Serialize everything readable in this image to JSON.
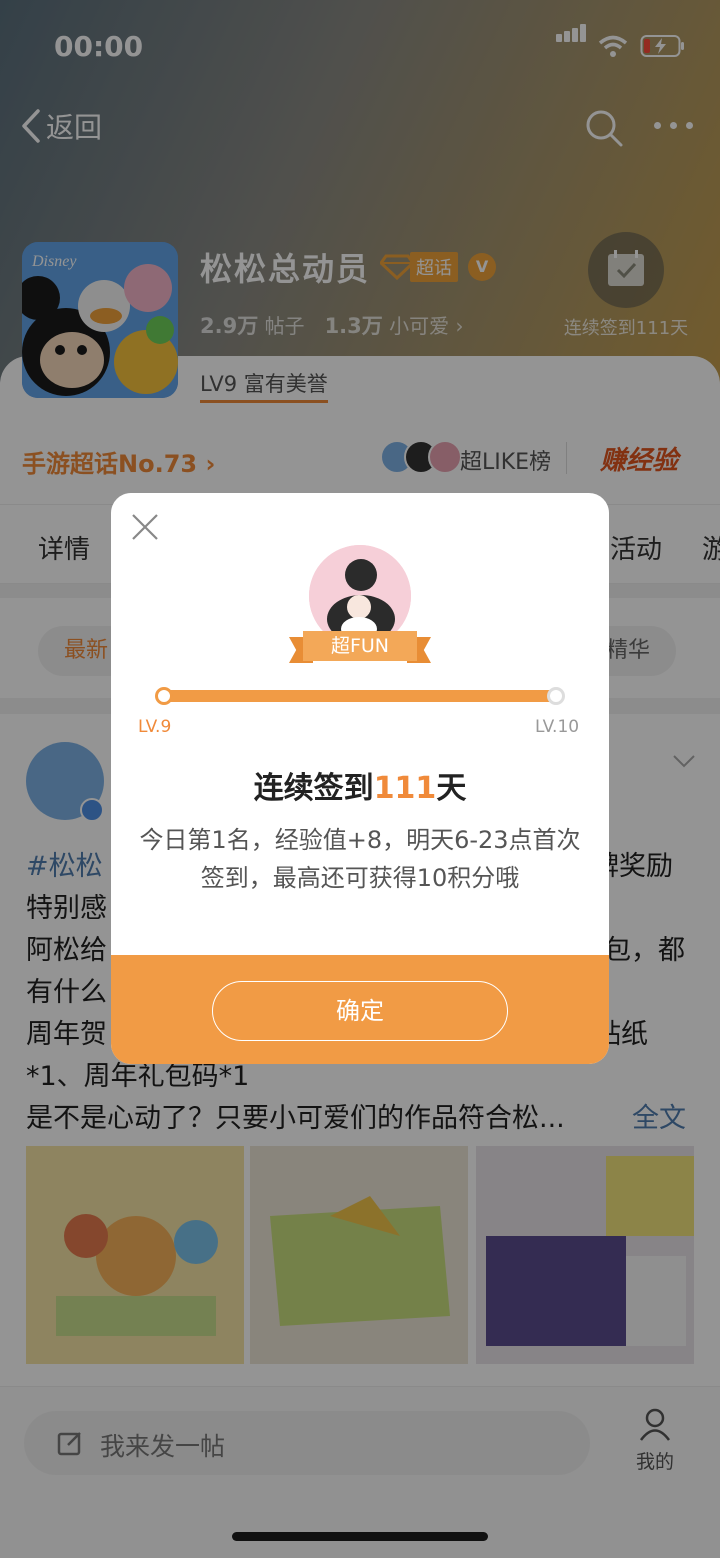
{
  "status": {
    "time": "00:00"
  },
  "nav": {
    "back_label": "返回"
  },
  "topic": {
    "name": "松松总动员",
    "super_label": "超话",
    "posts_count": "2.9万",
    "posts_label": "帖子",
    "fans_count": "1.3万",
    "fans_label": "小可爱",
    "level": "LV9 富有美誉",
    "checkin_label": "连续签到111天"
  },
  "rank": {
    "label": "手游超话No.73",
    "like_label": "超LIKE榜",
    "earn_label": "赚经验"
  },
  "tabs": [
    "详情",
    "活动",
    "游"
  ],
  "filters": {
    "latest": "最新",
    "essence": "精华"
  },
  "post": {
    "line1_tag": "#松松",
    "line1_tail": "牌奖励",
    "line2": "特别感",
    "line3_head": "阿松给",
    "line3_tail": "包，都",
    "line4": "有什么",
    "line5_head": "周年贺",
    "line5_tail": "贴纸",
    "line6": "*1、周年礼包码*1",
    "line7": "是不是心动了？只要小可爱们的作品符合松...",
    "full_text": "全文"
  },
  "bottom": {
    "compose_placeholder": "我来发一帖",
    "me_label": "我的"
  },
  "modal": {
    "badge": "超FUN",
    "level_from": "LV.9",
    "level_to": "LV.10",
    "progress": 1.0,
    "title_prefix": "连续签到",
    "title_days": "111",
    "title_suffix": "天",
    "desc": "今日第1名，经验值+8，明天6-23点首次签到，最高还可获得10积分哦",
    "confirm": "确定"
  },
  "colors": {
    "accent": "#f19b45",
    "link": "#507daf"
  }
}
